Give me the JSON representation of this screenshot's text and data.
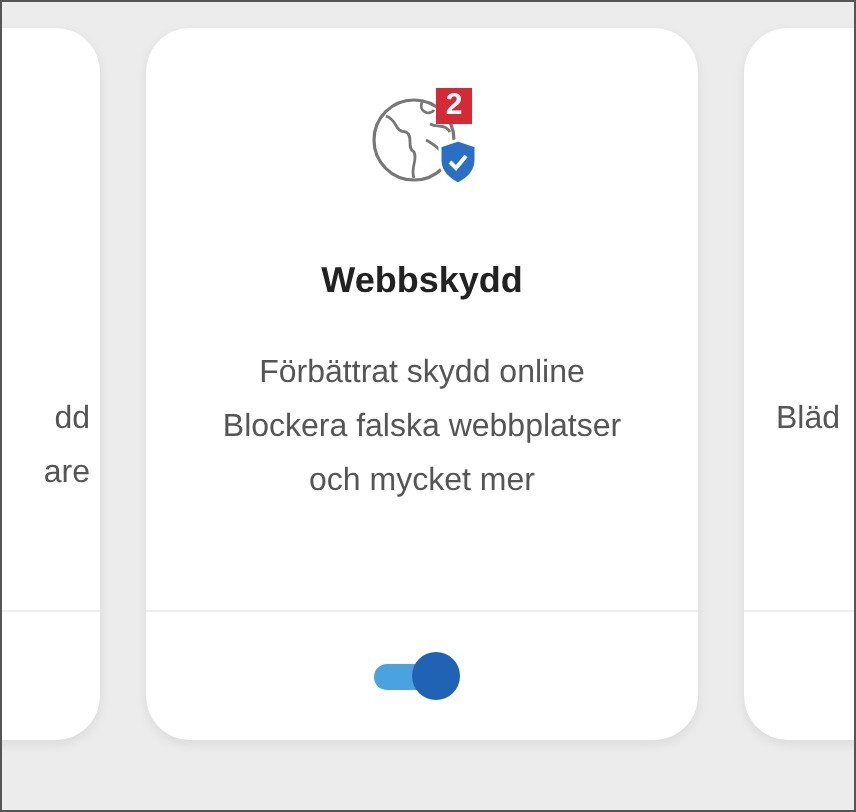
{
  "cards": [
    {
      "kind": "partial-left",
      "description_lines": [
        "dd",
        "are"
      ]
    },
    {
      "kind": "full",
      "title": "Webbskydd",
      "badge": "2",
      "description_lines": [
        "Förbättrat skydd online",
        "Blockera falska webbplatser",
        "och mycket mer"
      ],
      "toggle": {
        "on": true
      }
    },
    {
      "kind": "partial-right",
      "description_lines": [
        "Bläd"
      ]
    }
  ]
}
